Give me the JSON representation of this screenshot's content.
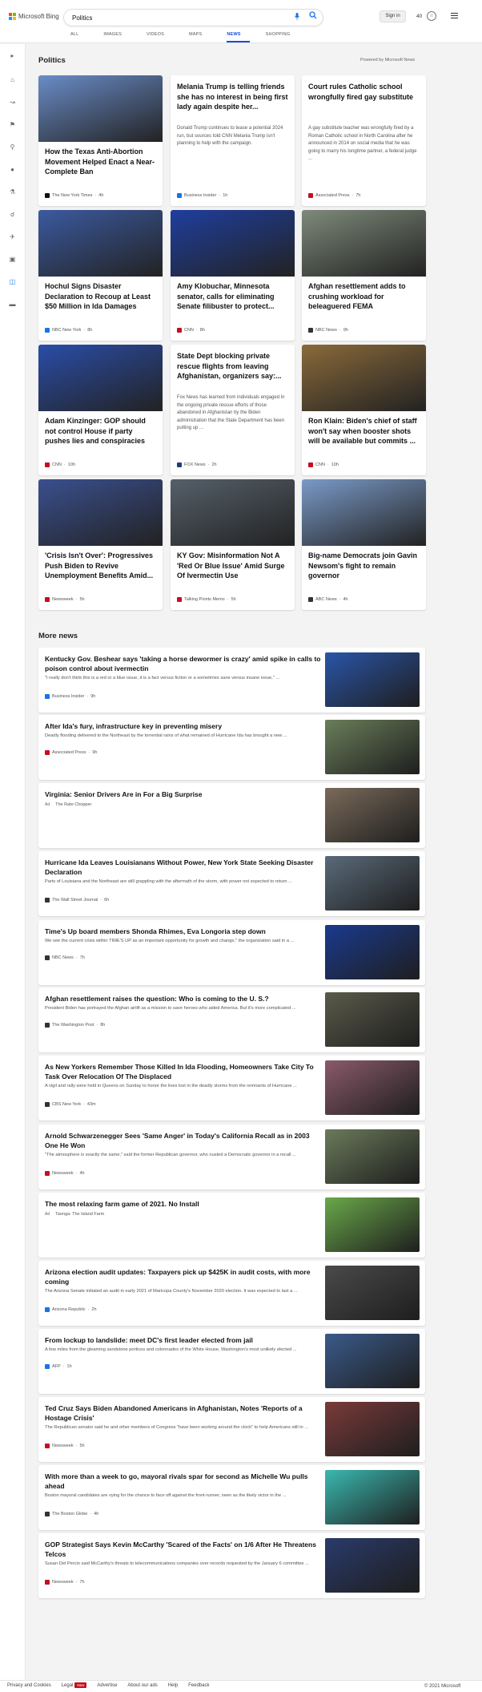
{
  "header": {
    "brand": "Microsoft Bing",
    "search_value": "Politics",
    "signin_label": "Sign in",
    "points": "40",
    "tabs": [
      {
        "label": "ALL"
      },
      {
        "label": "IMAGES"
      },
      {
        "label": "VIDEOS"
      },
      {
        "label": "MAPS"
      },
      {
        "label": "NEWS"
      },
      {
        "label": "SHOPPING"
      }
    ],
    "active_tab": "NEWS"
  },
  "sidebar": {
    "icons": [
      "expand-icon",
      "home-icon",
      "share-icon",
      "flag-icon",
      "location-icon",
      "globe-icon",
      "science-icon",
      "search-icon",
      "plane-icon",
      "video-icon",
      "briefcase-icon",
      "card-icon"
    ]
  },
  "politics": {
    "title": "Politics",
    "powered_by": "Powered by Microsoft News",
    "cards": [
      {
        "title": "How the Texas Anti-Abortion Movement Helped Enact a Near-Complete Ban",
        "source": "The New York Times",
        "age": "4h",
        "has_image": true,
        "image_color": "#6a8cc8",
        "logo_color": "#111111"
      },
      {
        "title": "Melania Trump is telling friends she has no interest in being first lady again despite her...",
        "snippet": "Donald Trump continues to tease a potential 2024 run, but sources told CNN Melania Trump isn't planning to help with the campaign.",
        "source": "Business Insider",
        "age": "1h",
        "has_image": false,
        "logo_color": "#1a73e8"
      },
      {
        "title": "Court rules Catholic school wrongfully fired gay substitute",
        "snippet": "A gay substitute teacher was wrongfully fired by a Roman Catholic school in North Carolina after he announced in 2014 on social media that he was going to marry his longtime partner, a federal judge ...",
        "source": "Associated Press",
        "age": "7h",
        "has_image": false,
        "logo_color": "#c50f1f"
      },
      {
        "title": "Hochul Signs Disaster Declaration to Recoup at Least $50 Million in Ida Damages",
        "source": "NBC New York",
        "age": "8h",
        "has_image": true,
        "image_color": "#3b5aa0",
        "logo_color": "#1a73e8"
      },
      {
        "title": "Amy Klobuchar, Minnesota senator, calls for eliminating Senate filibuster to protect...",
        "source": "CNN",
        "age": "8h",
        "has_image": true,
        "image_color": "#1f3e9e",
        "logo_color": "#c50f1f"
      },
      {
        "title": "Afghan resettlement adds to crushing workload for beleaguered FEMA",
        "source": "NBC News",
        "age": "9h",
        "has_image": true,
        "image_color": "#7e8a7a",
        "logo_color": "#333333"
      },
      {
        "title": "Adam Kinzinger: GOP should not control House if party pushes lies and conspiracies",
        "source": "CNN",
        "age": "10h",
        "has_image": true,
        "image_color": "#2a4da8",
        "logo_color": "#c50f1f"
      },
      {
        "title": "State Dept blocking private rescue flights from leaving Afghanistan, organizers say:...",
        "snippet": "Fox News has learned from individuals engaged in the ongoing private rescue efforts of those abandoned in Afghanistan by the Biden administration that the State Department has been putting up ...",
        "source": "FOX News",
        "age": "2h",
        "has_image": false,
        "logo_color": "#1f3e78"
      },
      {
        "title": "Ron Klain: Biden's chief of staff won't say when booster shots will be available but commits ...",
        "source": "CNN",
        "age": "10h",
        "has_image": true,
        "image_color": "#8a6a3a",
        "logo_color": "#c50f1f"
      },
      {
        "title": "'Crisis Isn't Over': Progressives Push Biden to Revive Unemployment Benefits Amid...",
        "source": "Newsweek",
        "age": "5h",
        "has_image": true,
        "image_color": "#3a4f8e",
        "logo_color": "#c50f1f"
      },
      {
        "title": "KY Gov: Misinformation Not A 'Red Or Blue Issue' Amid Surge Of Ivermectin Use",
        "source": "Talking Points Memo",
        "age": "5h",
        "has_image": true,
        "image_color": "#55606a",
        "logo_color": "#c50f1f"
      },
      {
        "title": "Big-name Democrats join Gavin Newsom's fight to remain governor",
        "source": "ABC News",
        "age": "4h",
        "has_image": true,
        "image_color": "#7a9ac8",
        "logo_color": "#333333"
      }
    ]
  },
  "more_news": {
    "title": "More news",
    "rows": [
      {
        "title": "Kentucky Gov. Beshear says 'taking a horse dewormer is crazy' amid spike in calls to poison control about ivermectin",
        "snippet": "\"I really don't think this is a red or a blue issue, it is a fact versus fiction or a sometimes sane versus insane issue,\" ...",
        "source": "Business Insider",
        "age": "9h",
        "ad": false,
        "image_color": "#2a55a8",
        "logo_color": "#1a73e8"
      },
      {
        "title": "After Ida's fury, infrastructure key in preventing misery",
        "snippet": "Deadly flooding delivered to the Northeast by the torrential rains of what remained of Hurricane Ida has brought a new ...",
        "source": "Associated Press",
        "age": "9h",
        "ad": false,
        "image_color": "#6a7e5a",
        "logo_color": "#c50f1f"
      },
      {
        "title": "Virginia: Senior Drivers Are in For a Big Surprise",
        "snippet": "",
        "source": "The Rate Chopper",
        "age": "",
        "ad": true,
        "ad_label": "Ad",
        "image_color": "#7a6a5a",
        "logo_color": "#999999"
      },
      {
        "title": "Hurricane Ida Leaves Louisianans Without Power, New York State Seeking Disaster Declaration",
        "snippet": "Parts of Louisiana and the Northeast are still grappling with the aftermath of the storm, with power not expected to return ...",
        "source": "The Wall Street Journal",
        "age": "6h",
        "ad": false,
        "image_color": "#5a6a7a",
        "logo_color": "#333333"
      },
      {
        "title": "Time's Up board members Shonda Rhimes, Eva Longoria step down",
        "snippet": "We see the current crisis within TIME'S UP as an important opportunity for growth and change,\" the organization said in a ...",
        "source": "NBC News",
        "age": "7h",
        "ad": false,
        "image_color": "#1a3a8e",
        "logo_color": "#333333"
      },
      {
        "title": "Afghan resettlement raises the question: Who is coming to the U. S.?",
        "snippet": "President Biden has portrayed the Afghan airlift as a mission to save heroes who aided America. But it's more complicated ...",
        "source": "The Washington Post",
        "age": "8h",
        "ad": false,
        "image_color": "#5a5a4a",
        "logo_color": "#333333"
      },
      {
        "title": "As New Yorkers Remember Those Killed In Ida Flooding, Homeowners Take City To Task Over Relocation Of The Displaced",
        "snippet": "A vigil and rally were held in Queens on Sunday to honor the lives lost in the deadly storms from the remnants of Hurricane ...",
        "source": "CBS New York",
        "age": "43m",
        "ad": false,
        "image_color": "#8a5a6a",
        "logo_color": "#333333"
      },
      {
        "title": "Arnold Schwarzenegger Sees 'Same Anger' in Today's California Recall as in 2003 One He Won",
        "snippet": "\"The atmosphere is exactly the same,\" said the former Republican governor, who ousted a Democratic governor in a recall ...",
        "source": "Newsweek",
        "age": "4h",
        "ad": false,
        "image_color": "#6a7a5a",
        "logo_color": "#c50f1f"
      },
      {
        "title": "The most relaxing farm game of 2021. No Install",
        "snippet": "",
        "source": "Taonga: The Island Farm",
        "age": "",
        "ad": true,
        "ad_label": "Ad",
        "image_color": "#6aa84a",
        "logo_color": "#999999"
      },
      {
        "title": "Arizona election audit updates: Taxpayers pick up $425K in audit costs, with more coming",
        "snippet": "The Arizona Senate initiated an audit in early 2021 of Maricopa County's November 2020 election. It was expected to last a ...",
        "source": "Arizona Republic",
        "age": "2h",
        "ad": false,
        "image_color": "#4a4a4a",
        "logo_color": "#1a73e8"
      },
      {
        "title": "From lockup to landslide: meet DC's first leader elected from jail",
        "snippet": "A few miles from the gleaming sandstone porticos and colonnades of the White House, Washington's most unlikely elected ...",
        "source": "AFP",
        "age": "1h",
        "ad": false,
        "image_color": "#3a5a8a",
        "logo_color": "#1a73e8"
      },
      {
        "title": "Ted Cruz Says Biden Abandoned Americans in Afghanistan, Notes 'Reports of a Hostage Crisis'",
        "snippet": "The Republican senator said he and other members of Congress \"have been working around the clock\" to help Americans still in ...",
        "source": "Newsweek",
        "age": "5h",
        "ad": false,
        "image_color": "#7a3a3a",
        "logo_color": "#c50f1f"
      },
      {
        "title": "With more than a week to go, mayoral rivals spar for second as Michelle Wu pulls ahead",
        "snippet": "Boston mayoral candidates are vying for the chance to face off against the front-runner, seen as the likely victor in the ...",
        "source": "The Boston Globe",
        "age": "4h",
        "ad": false,
        "image_color": "#3ab8b0",
        "logo_color": "#333333"
      },
      {
        "title": "GOP Strategist Says Kevin McCarthy 'Scared of the Facts' on 1/6 After He Threatens Telcos",
        "snippet": "Susan Del Percio said McCarthy's threats to telecommunications companies over records requested by the January 6 committee ...",
        "source": "Newsweek",
        "age": "7h",
        "ad": false,
        "image_color": "#2a3a6a",
        "logo_color": "#c50f1f"
      }
    ]
  },
  "footer": {
    "links": [
      "Privacy and Cookies",
      "Legal",
      "Advertise",
      "About our ads",
      "Help",
      "Feedback"
    ],
    "new_badge": "New",
    "copyright": "© 2021 Microsoft"
  }
}
